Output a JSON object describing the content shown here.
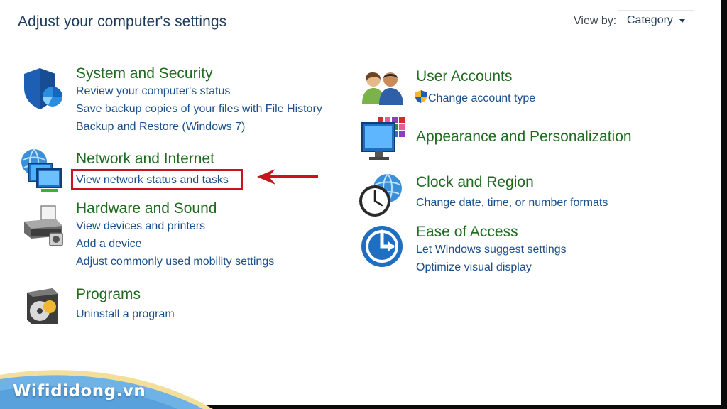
{
  "header": {
    "title": "Adjust your computer's settings"
  },
  "view_by": {
    "label": "View by:",
    "value": "Category"
  },
  "left_column": [
    {
      "title": "System and Security",
      "icon": "shield-icon",
      "links": [
        "Review your computer's status",
        "Save backup copies of your files with File History",
        "Backup and Restore (Windows 7)"
      ]
    },
    {
      "title": "Network and Internet",
      "icon": "network-icon",
      "links": [
        "View network status and tasks"
      ]
    },
    {
      "title": "Hardware and Sound",
      "icon": "printer-icon",
      "links": [
        "View devices and printers",
        "Add a device",
        "Adjust commonly used mobility settings"
      ]
    },
    {
      "title": "Programs",
      "icon": "programs-icon",
      "links": [
        "Uninstall a program"
      ]
    }
  ],
  "right_column": [
    {
      "title": "User Accounts",
      "icon": "users-icon",
      "links": [
        "Change account type"
      ],
      "link_icon": "uac-shield-icon"
    },
    {
      "title": "Appearance and Personalization",
      "icon": "monitor-icon",
      "links": []
    },
    {
      "title": "Clock and Region",
      "icon": "clock-globe-icon",
      "links": [
        "Change date, time, or number formats"
      ]
    },
    {
      "title": "Ease of Access",
      "icon": "ease-of-access-icon",
      "links": [
        "Let Windows suggest settings",
        "Optimize visual display"
      ]
    }
  ],
  "annotation": {
    "highlight_color": "#c8141b",
    "arrow_color": "#c8141b"
  },
  "watermark": {
    "text": "Wifididong.vn"
  },
  "colors": {
    "title_green": "#1f6b1f",
    "link_blue": "#1b4f8a",
    "header_navy": "#1e3b5c"
  }
}
